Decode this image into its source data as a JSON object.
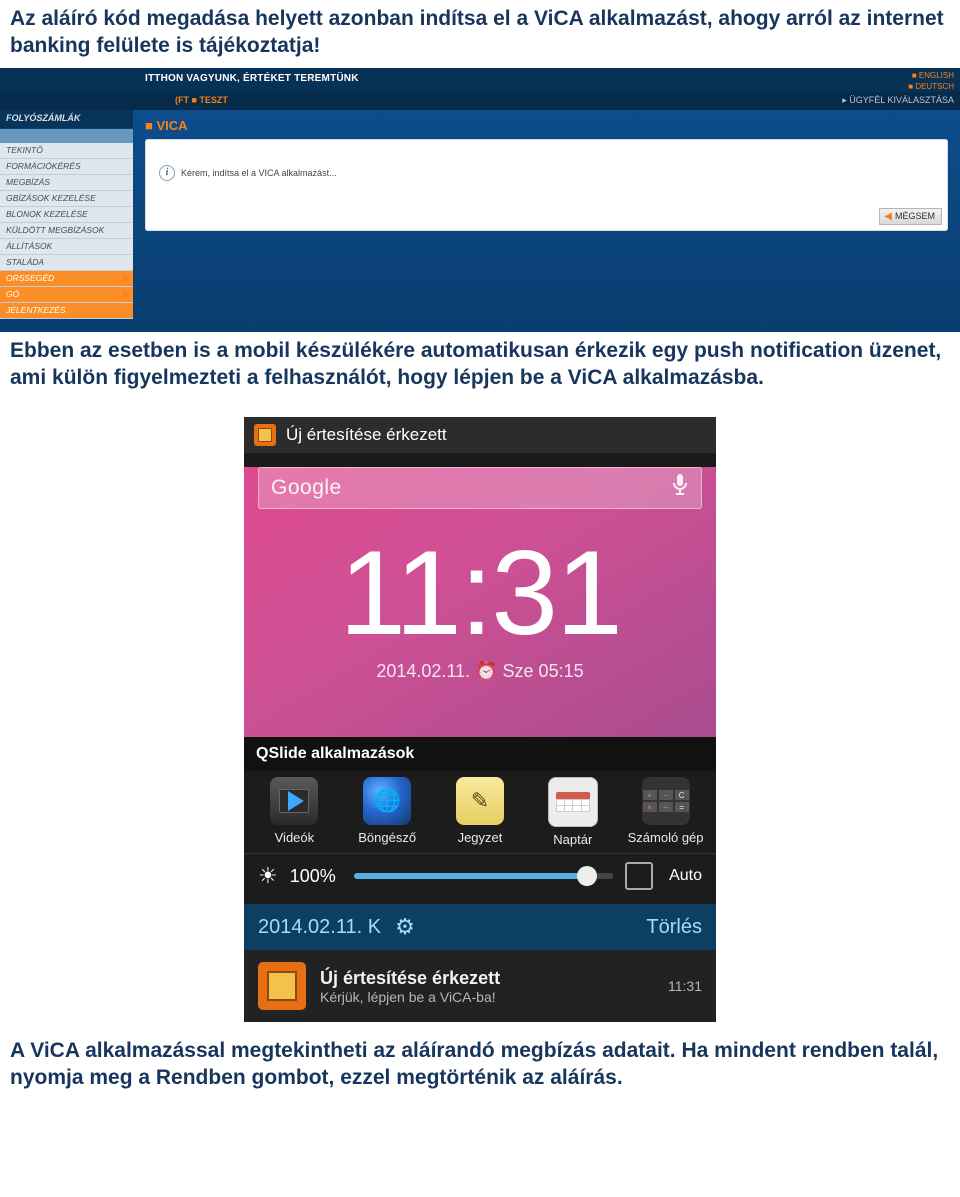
{
  "intro_text": "Az aláíró kód megadása helyett azonban indítsa el a ViCA alkalmazást, ahogy arról az internet banking felülete is tájékoztatja!",
  "middle_text": "Ebben az esetben is a mobil készülékére automatikusan érkezik egy push notification üzenet, ami külön figyelmezteti a felhasználót, hogy lépjen be a ViCA alkalmazásba.",
  "outro_text": "A ViCA alkalmazással megtekintheti az aláírandó megbízás adatait. Ha mindent rendben talál, nyomja meg a Rendben gombot, ezzel megtörténik az aláírás.",
  "bank": {
    "tagline": "ITTHON VAGYUNK, ÉRTÉKET TEREMTÜNK",
    "lang1": "■ ENGLISH",
    "lang2": "■ DEUTSCH",
    "ft_teszt": "(FT   ■ TESZT",
    "ugyfel": "▸ ÜGYFÉL KIVÁLASZTÁSA",
    "sidebar": {
      "cat1": "FOLYÓSZÁMLÁK",
      "items1": [
        "TEKINTŐ",
        "FORMÁCIÓKÉRÉS",
        "MEGBÍZÁS",
        "GBÍZÁSOK KEZELÉSE",
        "BLONOK KEZELÉSE",
        "KÜLDÖTT MEGBÍZÁSOK",
        "ÁLLÍTÁSOK",
        "STALÁDA"
      ],
      "gyors": "ORSSEGÉD",
      "go": "GÓ",
      "kijel": "JELENTKEZÉS"
    },
    "panel": {
      "title": "■ VICA",
      "msg": "Kérem, indítsa el a VICA alkalmazást...",
      "megsem": "MÉGSEM"
    }
  },
  "phone": {
    "status": "Új értesítése érkezett",
    "google": "Google",
    "clock": "11:31",
    "clock_sub": "2014.02.11.  ⏰ Sze 05:15",
    "qslide_header": "QSlide alkalmazások",
    "apps": {
      "video": "Videók",
      "browser": "Böngésző",
      "note": "Jegyzet",
      "calendar": "Naptár",
      "calc": "Számoló gép"
    },
    "brightness_pct": "100%",
    "auto": "Auto",
    "date_row": "2014.02.11. K",
    "torles": "Törlés",
    "notif_title": "Új értesítése érkezett",
    "notif_sub": "Kérjük, lépjen be a ViCA-ba!",
    "notif_time": "11:31"
  }
}
